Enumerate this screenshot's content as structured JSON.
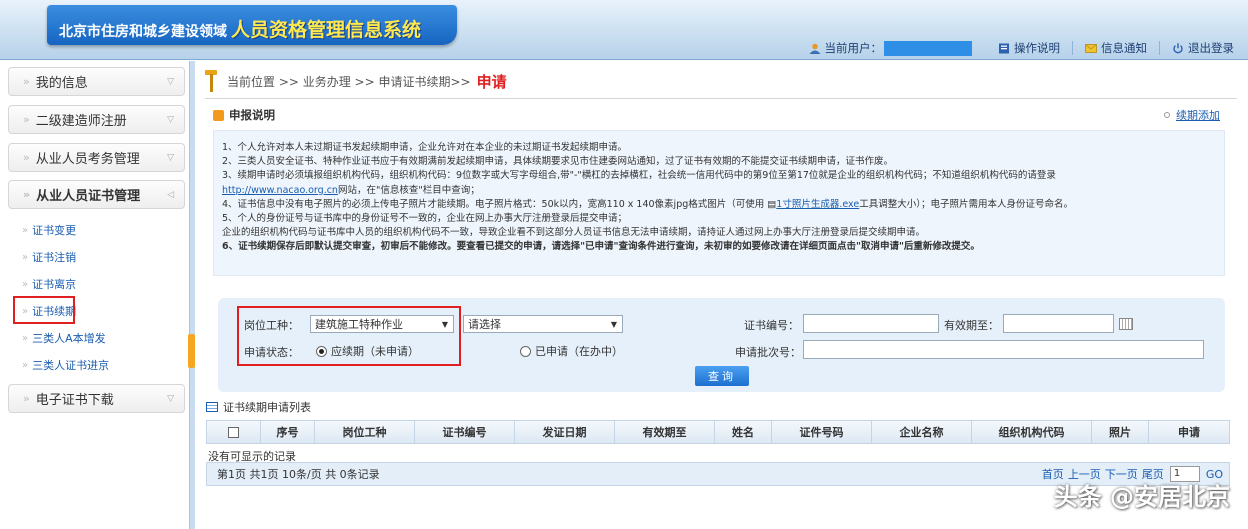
{
  "header": {
    "title_small": "北京市住房和城乡建设领域",
    "title_big": "人员资格管理信息系统",
    "current_user_label": "当前用户：",
    "nav": [
      {
        "label": "操作说明",
        "icon": "help-icon"
      },
      {
        "label": "信息通知",
        "icon": "mail-icon"
      },
      {
        "label": "退出登录",
        "icon": "power-icon"
      }
    ]
  },
  "sidebar": {
    "menus": [
      {
        "label": "我的信息"
      },
      {
        "label": "二级建造师注册"
      },
      {
        "label": "从业人员考务管理"
      },
      {
        "label": "从业人员证书管理"
      }
    ],
    "sub_items": [
      {
        "label": "证书变更"
      },
      {
        "label": "证书注销"
      },
      {
        "label": "证书离京"
      },
      {
        "label": "证书续期"
      },
      {
        "label": "三类人A本增发"
      },
      {
        "label": "三类人证书进京"
      }
    ],
    "bottom_menu": {
      "label": "电子证书下载"
    }
  },
  "breadcrumb": {
    "prefix": "当前位置 >> 业务办理 >> 申请证书续期>>",
    "current": "申请"
  },
  "notice": {
    "title": "申报说明",
    "add_link": "续期添加",
    "lines": [
      "1、个人允许对本人未过期证书发起续期申请，企业允许对在本企业的未过期证书发起续期申请。",
      "2、三类人员安全证书、特种作业证书应于有效期满前发起续期申请，具体续期要求见市住建委网站通知，过了证书有效期的不能提交证书续期申请，证书作废。",
      "3、续期申请时必须填报组织机构代码，组织机构代码：9位数字或大写字母组合,带\"-\"横杠的去掉横杠，社会统一信用代码中的第9位至第17位就是企业的组织机构代码；不知道组织机构代码的请登录",
      "网站，在\"信息核查\"栏目中查询；",
      "4、证书信息中没有电子照片的必须上传电子照片才能续期。电子照片格式：50k以内，宽高110 x 140像素jpg格式图片（可使用",
      "工具调整大小）；电子照片需用本人身份证号命名。",
      "5、个人的身份证号与证书库中的身份证号不一致的，企业在网上办事大厅注册登录后提交申请；",
      "企业的组织机构代码与证书库中人员的组织机构代码不一致，导致企业看不到这部分人员证书信息无法申请续期，请持证人通过网上办事大厅注册登录后提交续期申请。",
      "6、证书续期保存后即默认提交审查，初审后不能修改。要查看已提交的申请，请选择\"已申请\"查询条件进行查询，未初审的如要修改请在详细页面点击\"取消申请\"后重新修改提交。"
    ],
    "url_link": "http://www.nacao.org.cn",
    "tool_link": "1寸照片生成器.exe"
  },
  "query": {
    "post_type_label": "岗位工种：",
    "post_type_value": "建筑施工特种作业",
    "post_type_sub_value": "请选择",
    "cert_no_label": "证书编号：",
    "valid_until_label": "有效期至：",
    "status_label": "申请状态：",
    "status_option1": "应续期（未申请）",
    "status_option2": "已申请（在办中）",
    "batch_no_label": "申请批次号：",
    "query_button": "查询"
  },
  "list": {
    "title": "证书续期申请列表",
    "columns": [
      "序号",
      "岗位工种",
      "证书编号",
      "发证日期",
      "有效期至",
      "姓名",
      "证件号码",
      "企业名称",
      "组织机构代码",
      "照片",
      "申请"
    ],
    "empty_text": "没有可显示的记录",
    "pager": {
      "info": "第1页  共1页  10条/页  共 0条记录",
      "first": "首页",
      "prev": "上一页",
      "next": "下一页",
      "last": "尾页",
      "page_value": "1",
      "go": "GO"
    }
  },
  "watermark": "头条 @安居北京",
  "colors": {
    "accent": "#1d6fcf",
    "highlight": "#e02020",
    "banner": "#1665c1"
  }
}
